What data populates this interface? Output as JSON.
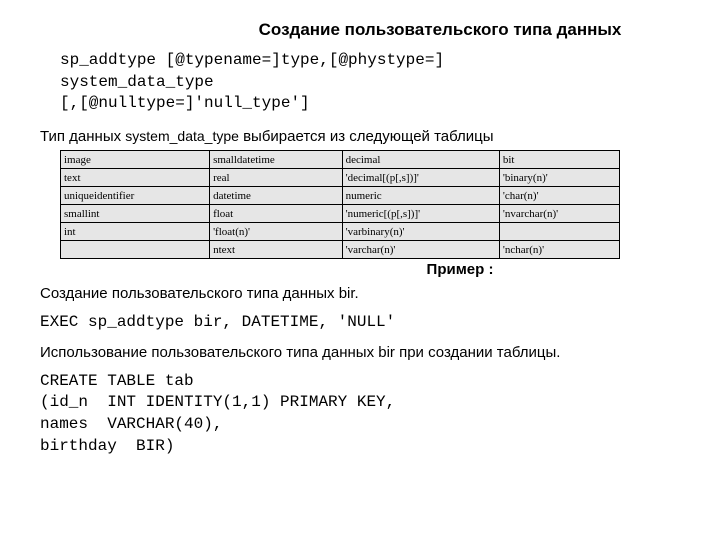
{
  "title": "Создание пользовательского типа данных",
  "syntax": "sp_addtype [@typename=]type,[@phystype=]\nsystem_data_type\n[,[@nulltype=]'null_type']",
  "table_intro_prefix": "Тип данных ",
  "table_intro_mono": "system_data_type",
  "table_intro_suffix": " выбирается из следующей таблицы",
  "table": {
    "rows": [
      [
        "image",
        "smalldatetime",
        "decimal",
        "bit"
      ],
      [
        "text",
        "real",
        "'decimal[(p[,s])]'",
        "'binary(n)'"
      ],
      [
        "uniqueidentifier",
        "datetime",
        "numeric",
        "'char(n)'"
      ],
      [
        "smallint",
        "float",
        "'numeric[(p[,s])]'",
        "'nvarchar(n)'"
      ],
      [
        "int",
        "'float(n)'",
        "'varbinary(n)'",
        ""
      ],
      [
        "",
        "ntext",
        "'varchar(n)'",
        "'nchar(n)'"
      ]
    ]
  },
  "example_label": "Пример :",
  "example_text1": "Создание пользовательского типа данных bir.",
  "example_code1": "EXEC sp_addtype bir, DATETIME, 'NULL'",
  "example_text2": "Использование пользовательского типа данных bir при создании таблицы.",
  "example_code2": "CREATE TABLE tab\n(id_n  INT IDENTITY(1,1) PRIMARY KEY,\nnames  VARCHAR(40),\nbirthday  BIR)"
}
